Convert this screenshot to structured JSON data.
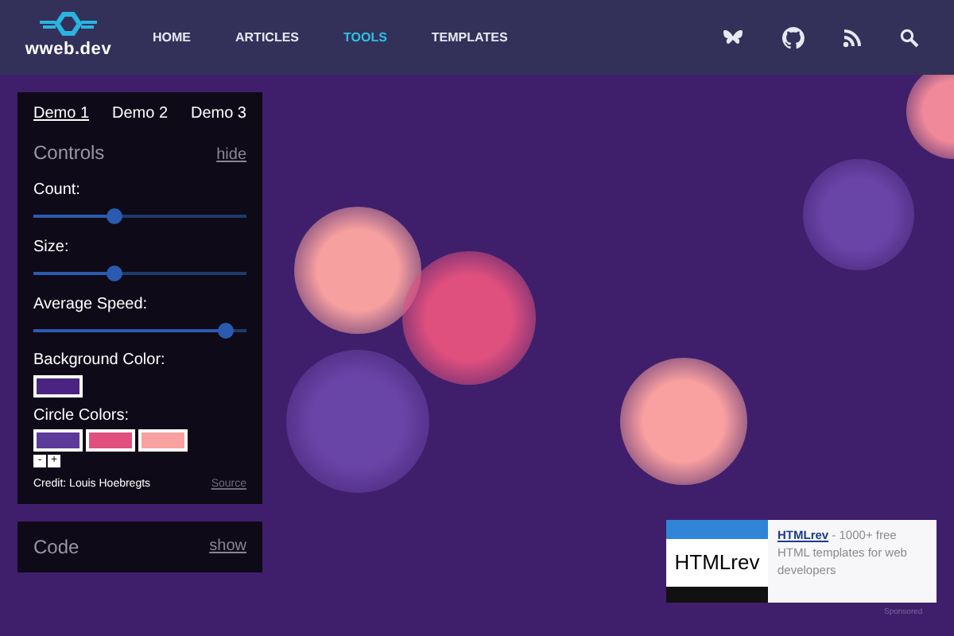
{
  "header": {
    "logo": "wweb.dev",
    "nav": [
      {
        "label": "HOME",
        "selected": false
      },
      {
        "label": "ARTICLES",
        "selected": false
      },
      {
        "label": "TOOLS",
        "selected": true
      },
      {
        "label": "TEMPLATES",
        "selected": false
      }
    ]
  },
  "panel": {
    "tabs": [
      {
        "label": "Demo 1",
        "selected": true
      },
      {
        "label": "Demo 2",
        "selected": false
      },
      {
        "label": "Demo 3",
        "selected": false
      }
    ],
    "title": "Controls",
    "toggle": "hide",
    "sliders": [
      {
        "label": "Count:",
        "level": 0.38
      },
      {
        "label": "Size:",
        "level": 0.38
      },
      {
        "label": "Average Speed:",
        "level": 0.9
      }
    ],
    "background_color": {
      "label": "Background Color:",
      "color": "#4a2480"
    },
    "circle_colors": {
      "label": "Circle Colors:",
      "swatches": [
        {
          "color": "#5b3a9a"
        },
        {
          "color": "#e0507f"
        },
        {
          "color": "#f9a0a0"
        }
      ],
      "buttons": [
        "-",
        "+"
      ]
    },
    "credit": "Credit: Louis Hoebregts",
    "source": "Source"
  },
  "code_panel": {
    "title": "Code",
    "toggle": "show"
  },
  "ad": {
    "image_text": "HTMLrev",
    "link": "HTMLrev",
    "text": " - 1000+ free HTML templates for web developers",
    "label": "Sponsored"
  },
  "circles": [
    {
      "color": "#f7a0a0"
    },
    {
      "color": "#e0507f"
    },
    {
      "color": "#f9a0a0"
    },
    {
      "color": "#6a45a8"
    },
    {
      "color": "#6a45a8"
    },
    {
      "color": "#f08a9a"
    }
  ]
}
